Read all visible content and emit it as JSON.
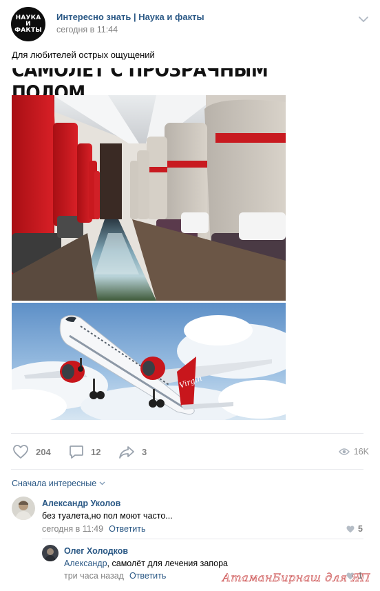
{
  "post": {
    "group_name": "Интересно знать | Наука и факты",
    "group_avatar_lines": [
      "НАУКА",
      "И",
      "ФАКТЫ"
    ],
    "time": "сегодня в 11:44",
    "text": "Для любителей острых ощущений",
    "image_title": "САМОЛЕТ С ПРОЗРАЧНЫМ ПОЛОМ",
    "image_brand": "Virgin"
  },
  "actions": {
    "likes": "204",
    "comments": "12",
    "shares": "3",
    "views": "16K"
  },
  "comments_section": {
    "sort_label": "Сначала интересные"
  },
  "comments": [
    {
      "author": "Александр Уколов",
      "text": "без туалета,но пол моют часто...",
      "time": "сегодня в 11:49",
      "reply_label": "Ответить",
      "likes": "5"
    },
    {
      "author": "Олег Холодков",
      "mention": "Александр",
      "text": ", самолёт для лечения запора",
      "time": "три часа назад",
      "reply_label": "Ответить",
      "likes": "1"
    }
  ],
  "watermark": "АтаманБирнаш для ЯП",
  "colors": {
    "link": "#2a5885",
    "meta": "#828282",
    "divider": "#e7e8ec",
    "seat_red": "#c8181e"
  }
}
